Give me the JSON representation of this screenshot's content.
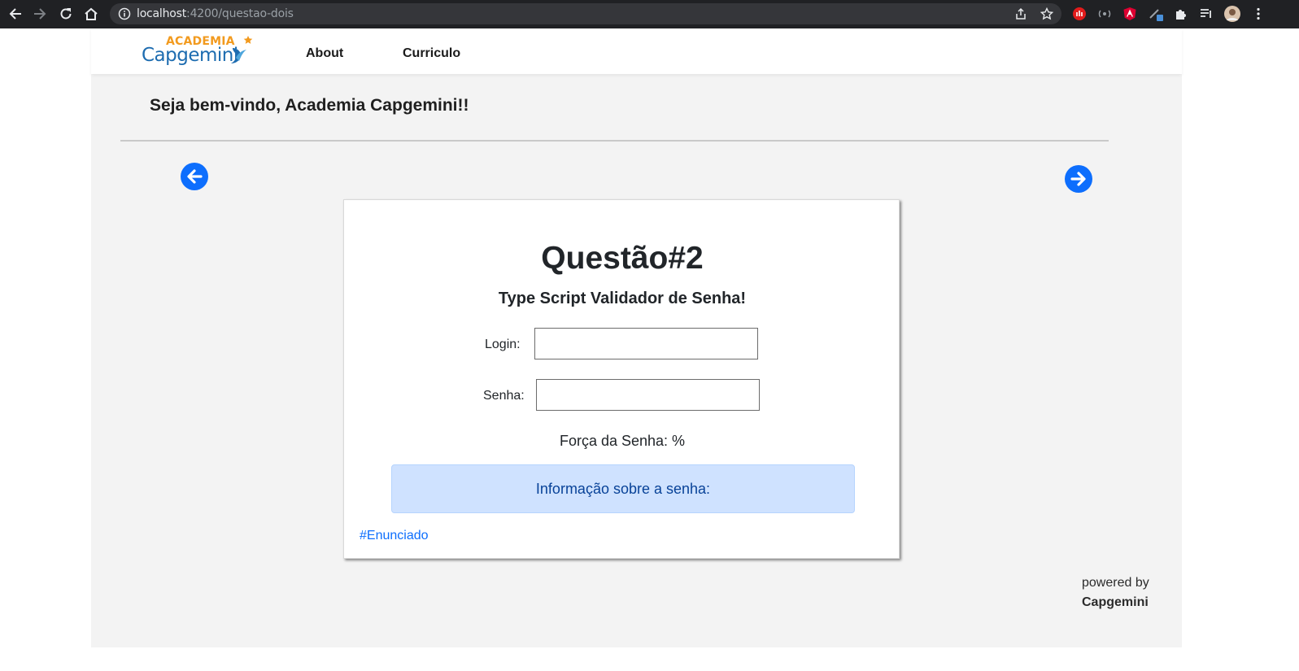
{
  "browser": {
    "url_host": "localhost",
    "url_path": ":4200/questao-dois",
    "icons": [
      "back-icon",
      "forward-icon",
      "reload-icon",
      "home-icon",
      "info-icon",
      "share-icon",
      "star-icon",
      "extensions-icon",
      "reading-list-icon",
      "profile-avatar",
      "more-icon"
    ]
  },
  "header": {
    "logo_top": "ACADEMIA",
    "logo_main": "Capgemini",
    "nav": [
      {
        "label": "About"
      },
      {
        "label": "Curriculo"
      }
    ]
  },
  "main": {
    "welcome": "Seja bem-vindo, Academia Capgemini!!",
    "prev_icon": "arrow-left-circle-icon",
    "next_icon": "arrow-right-circle-icon"
  },
  "card": {
    "title": "Questão#2",
    "subtitle": "Type Script Validador de Senha!",
    "login_label": "Login:",
    "login_value": "",
    "password_label": "Senha:",
    "password_value": "",
    "strength_label": "Força da Senha: %",
    "info_text": "Informação sobre a senha:",
    "link": "#Enunciado"
  },
  "footer": {
    "powered_by": "powered by",
    "brand": "Capgemini"
  },
  "colors": {
    "primary": "#0d6efd",
    "alert_bg": "#cfe2ff",
    "alert_text": "#084298",
    "logo_orange": "#f29a1e",
    "logo_blue": "#1d6cb0",
    "chrome_bg": "#202124"
  }
}
